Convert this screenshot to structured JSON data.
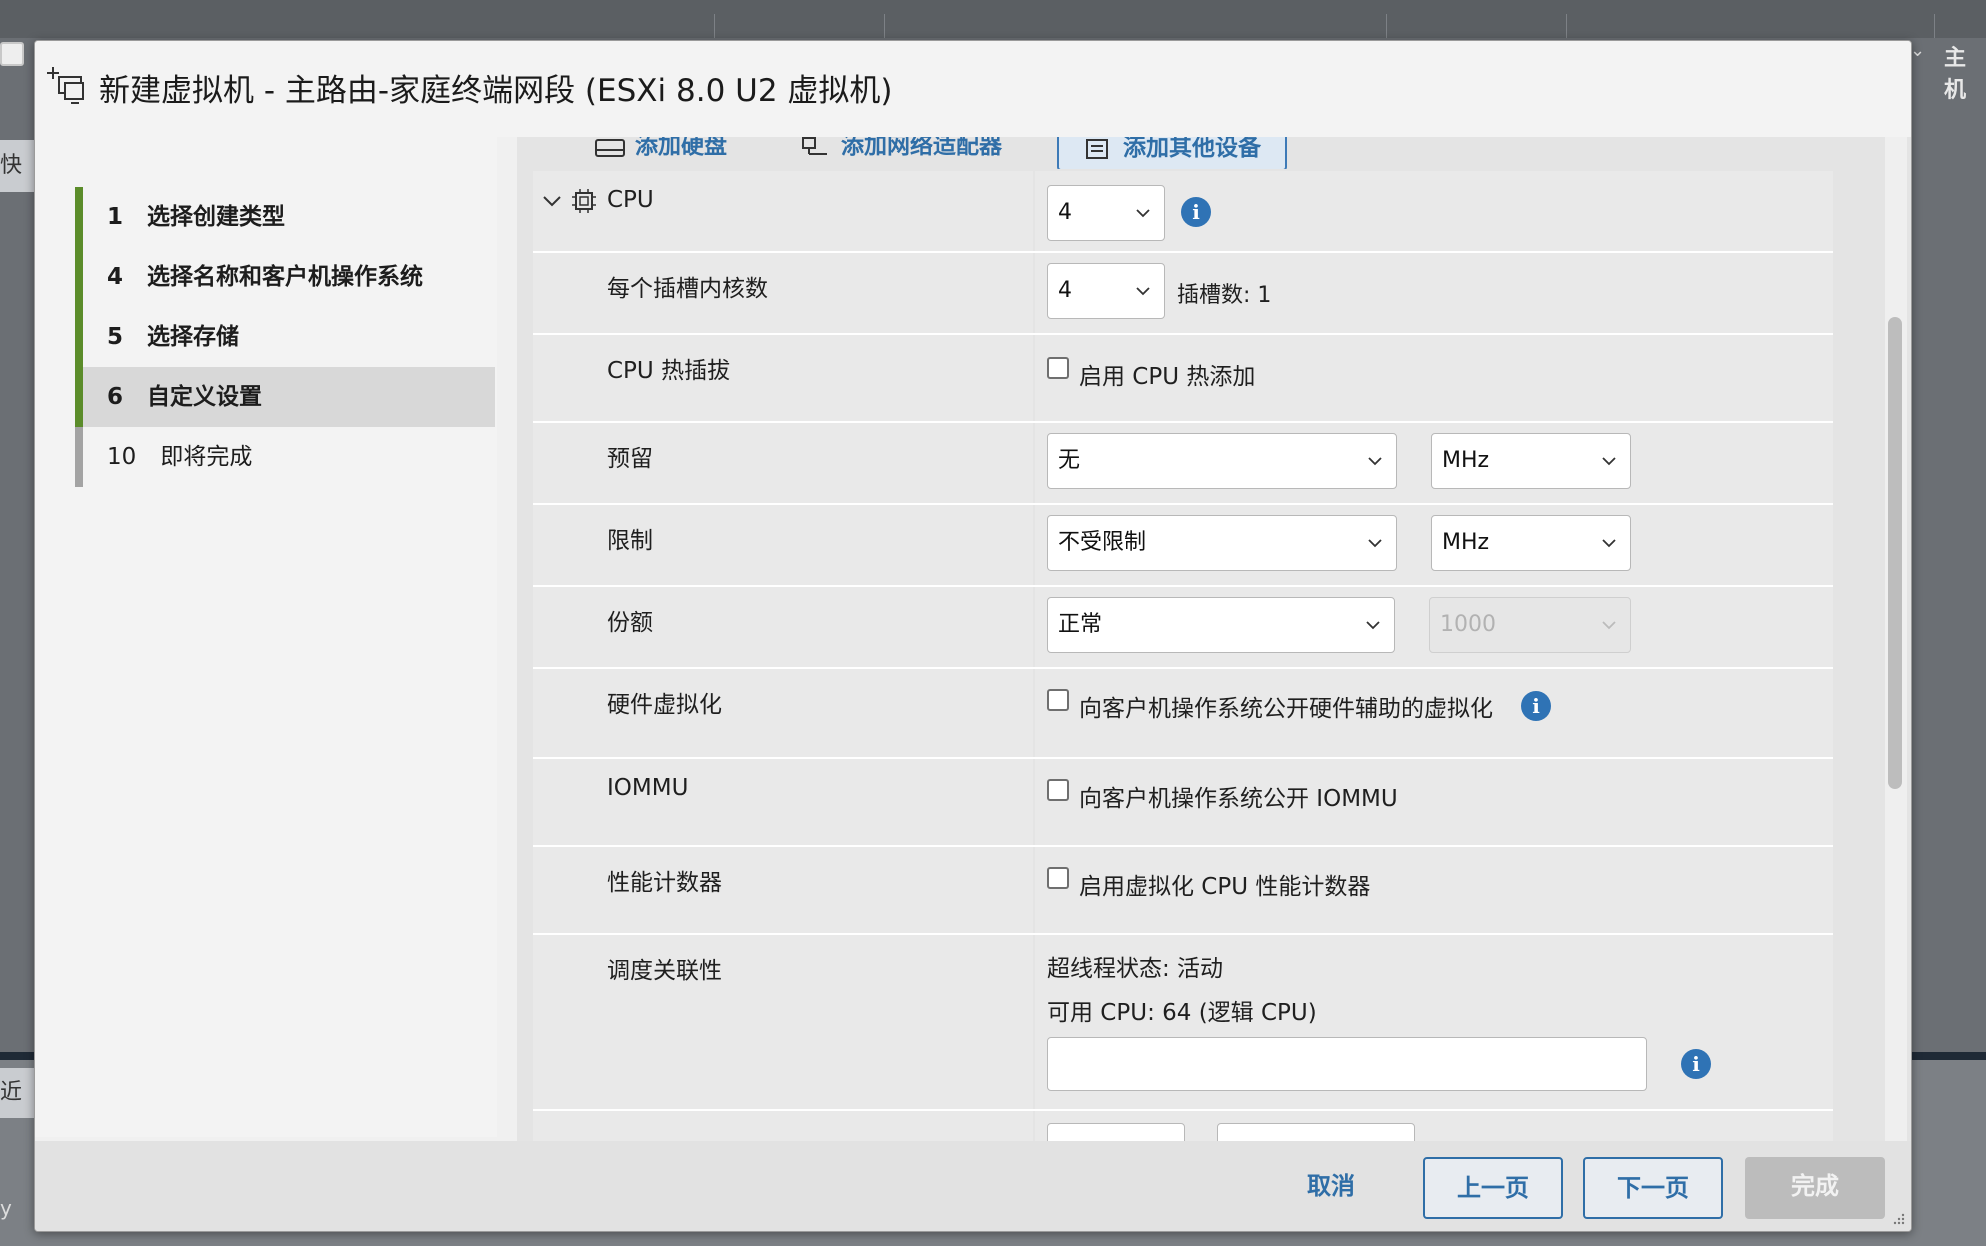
{
  "background": {
    "right_label": "主机",
    "left_tab_1": "快过",
    "left_tab_2": "近期",
    "left_tab_3": "y Vi"
  },
  "dialog": {
    "title": "新建虚拟机 - 主路由-家庭终端网段 (ESXi 8.0 U2 虚拟机)"
  },
  "steps": [
    {
      "num": "1",
      "label": "选择创建类型",
      "state": "done"
    },
    {
      "num": "4",
      "label": "选择名称和客户机操作系统",
      "state": "done"
    },
    {
      "num": "5",
      "label": "选择存储",
      "state": "done"
    },
    {
      "num": "6",
      "label": "自定义设置",
      "state": "active"
    },
    {
      "num": "10",
      "label": "即将完成",
      "state": "todo"
    }
  ],
  "add_bar": {
    "add_disk": "添加硬盘",
    "add_nic": "添加网络适配器",
    "add_other": "添加其他设备"
  },
  "cpu": {
    "header": "CPU",
    "count": "4",
    "cores_label": "每个插槽内核数",
    "cores_value": "4",
    "sockets_text": "插槽数: 1",
    "hotplug_label": "CPU 热插拔",
    "hotplug_checkbox": "启用 CPU 热添加",
    "reservation_label": "预留",
    "reservation_value": "无",
    "reservation_unit": "MHz",
    "limit_label": "限制",
    "limit_value": "不受限制",
    "limit_unit": "MHz",
    "shares_label": "份额",
    "shares_value": "正常",
    "shares_number": "1000",
    "hwvirt_label": "硬件虚拟化",
    "hwvirt_checkbox": "向客户机操作系统公开硬件辅助的虚拟化",
    "iommu_label": "IOMMU",
    "iommu_checkbox": "向客户机操作系统公开 IOMMU",
    "perf_label": "性能计数器",
    "perf_checkbox": "启用虚拟化 CPU 性能计数器",
    "affinity_label": "调度关联性",
    "hyperthread_status": "超线程状态: 活动",
    "available_cpu": "可用 CPU: 64 (逻辑 CPU)",
    "affinity_value": ""
  },
  "footer": {
    "cancel": "取消",
    "back": "上一页",
    "next": "下一页",
    "finish": "完成"
  },
  "colors": {
    "accent": "#2f6ea7",
    "step_done": "#5b8c2a",
    "step_todo": "#a3a3a3",
    "info": "#2f73b5"
  }
}
